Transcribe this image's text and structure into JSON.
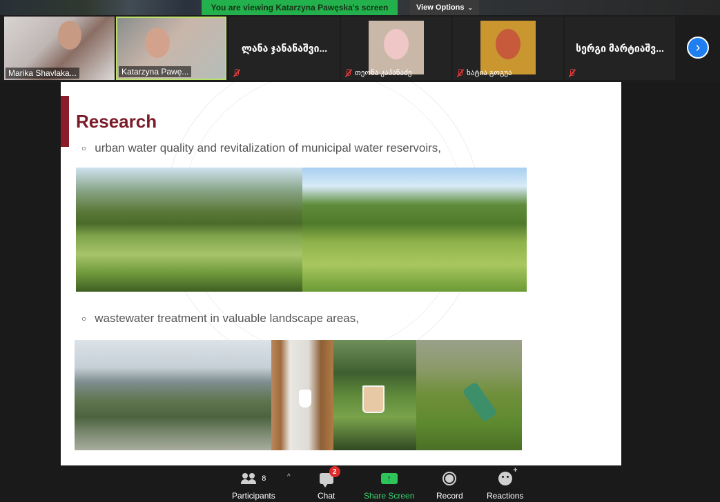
{
  "banner": {
    "viewing_text": "You are viewing Katarzyna Pawęska's screen",
    "view_options_label": "View Options"
  },
  "participants": [
    {
      "name": "Marika Shavlaka...",
      "type": "video"
    },
    {
      "name": "Katarzyna Pawę...",
      "type": "video",
      "active_speaker": true
    },
    {
      "name": "ლანა ჯანანაშვი...",
      "type": "name",
      "muted": true
    },
    {
      "name": "თეონა კაპანაძე",
      "type": "avatar",
      "muted": true
    },
    {
      "name": "ხატია გოგუა",
      "type": "avatar",
      "muted": true
    },
    {
      "name": "სერგი მარტიაშვ...",
      "type": "name",
      "muted": true
    }
  ],
  "slide": {
    "title": "Research",
    "bullets": [
      "urban water quality and revitalization of municipal water reservoirs,",
      "wastewater treatment in valuable landscape areas,"
    ]
  },
  "toolbar": {
    "participants_label": "Participants",
    "participants_count": "8",
    "chat_label": "Chat",
    "chat_badge": "2",
    "share_label": "Share Screen",
    "record_label": "Record",
    "reactions_label": "Reactions"
  },
  "colors": {
    "banner_green": "#22b14c",
    "title_maroon": "#7a1c2a",
    "share_green": "#3cd070",
    "badge_red": "#e02b2b"
  }
}
